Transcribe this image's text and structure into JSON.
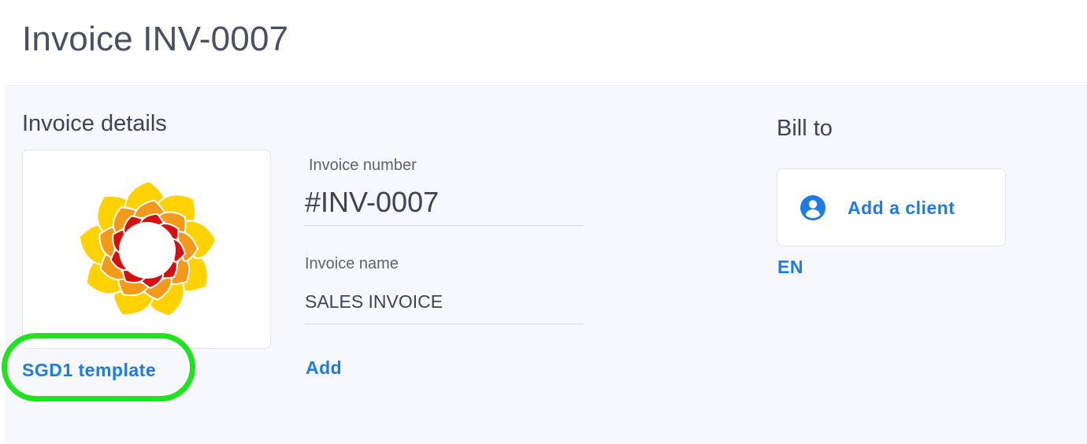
{
  "header": {
    "title": "Invoice INV-0007"
  },
  "invoice_details": {
    "heading": "Invoice details",
    "template_link": "SGD1 template",
    "invoice_number_label": "Invoice number",
    "invoice_number_value": "#INV-0007",
    "invoice_name_label": "Invoice name",
    "invoice_name_value": "SALES INVOICE",
    "add_link": "Add"
  },
  "bill_to": {
    "heading": "Bill to",
    "add_client_label": "Add a client",
    "language_link": "EN"
  },
  "icons": {
    "logo": "sunflower-logo-icon",
    "client": "account-circle-icon"
  },
  "colors": {
    "accent": "#1d7ce4",
    "highlight": "#1fe31f",
    "title_text": "#4a5064",
    "content_bg": "#f6f8fd"
  }
}
